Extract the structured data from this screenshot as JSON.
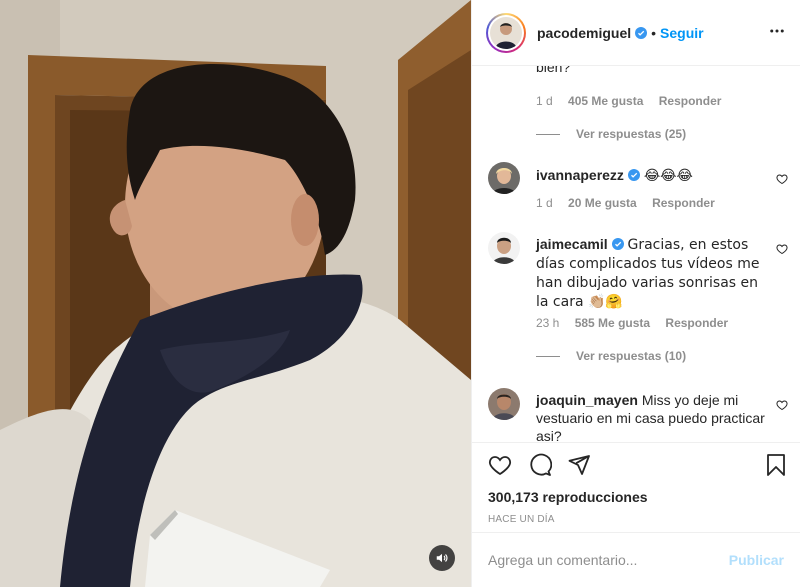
{
  "header": {
    "username": "pacodemiguel",
    "separator": "•",
    "follow_label": "Seguir"
  },
  "comments": {
    "partial": {
      "text_tail": "bien?",
      "time": "1 d",
      "likes": "405 Me gusta",
      "reply_label": "Responder",
      "view_replies": "Ver respuestas (25)"
    },
    "items": [
      {
        "user": "ivannaperezz",
        "text": "😂😂😂",
        "time": "1 d",
        "likes": "20 Me gusta",
        "reply_label": "Responder"
      },
      {
        "user": "jaimecamil",
        "text": "Gracias, en estos días complicados tus vídeos me han dibujado varias sonrisas en la cara 👏🏼🤗",
        "time": "23 h",
        "likes": "585 Me gusta",
        "reply_label": "Responder",
        "view_replies": "Ver respuestas (10)"
      },
      {
        "user": "joaquin_mayen",
        "text": "Miss yo deje mi vestuario en mi casa puedo practicar asi?"
      }
    ]
  },
  "actions": {
    "icons": [
      "heart-icon",
      "comment-icon",
      "share-icon",
      "bookmark-icon"
    ]
  },
  "stats": {
    "views": "300,173 reproducciones",
    "time_ago": "HACE UN DÍA"
  },
  "comment_box": {
    "placeholder": "Agrega un comentario...",
    "publish_label": "Publicar"
  },
  "colors": {
    "link_blue": "#0095f6",
    "publish_disabled": "#b2dffc",
    "muted_text": "#8e8e8e",
    "verified_blue": "#3897f0"
  }
}
